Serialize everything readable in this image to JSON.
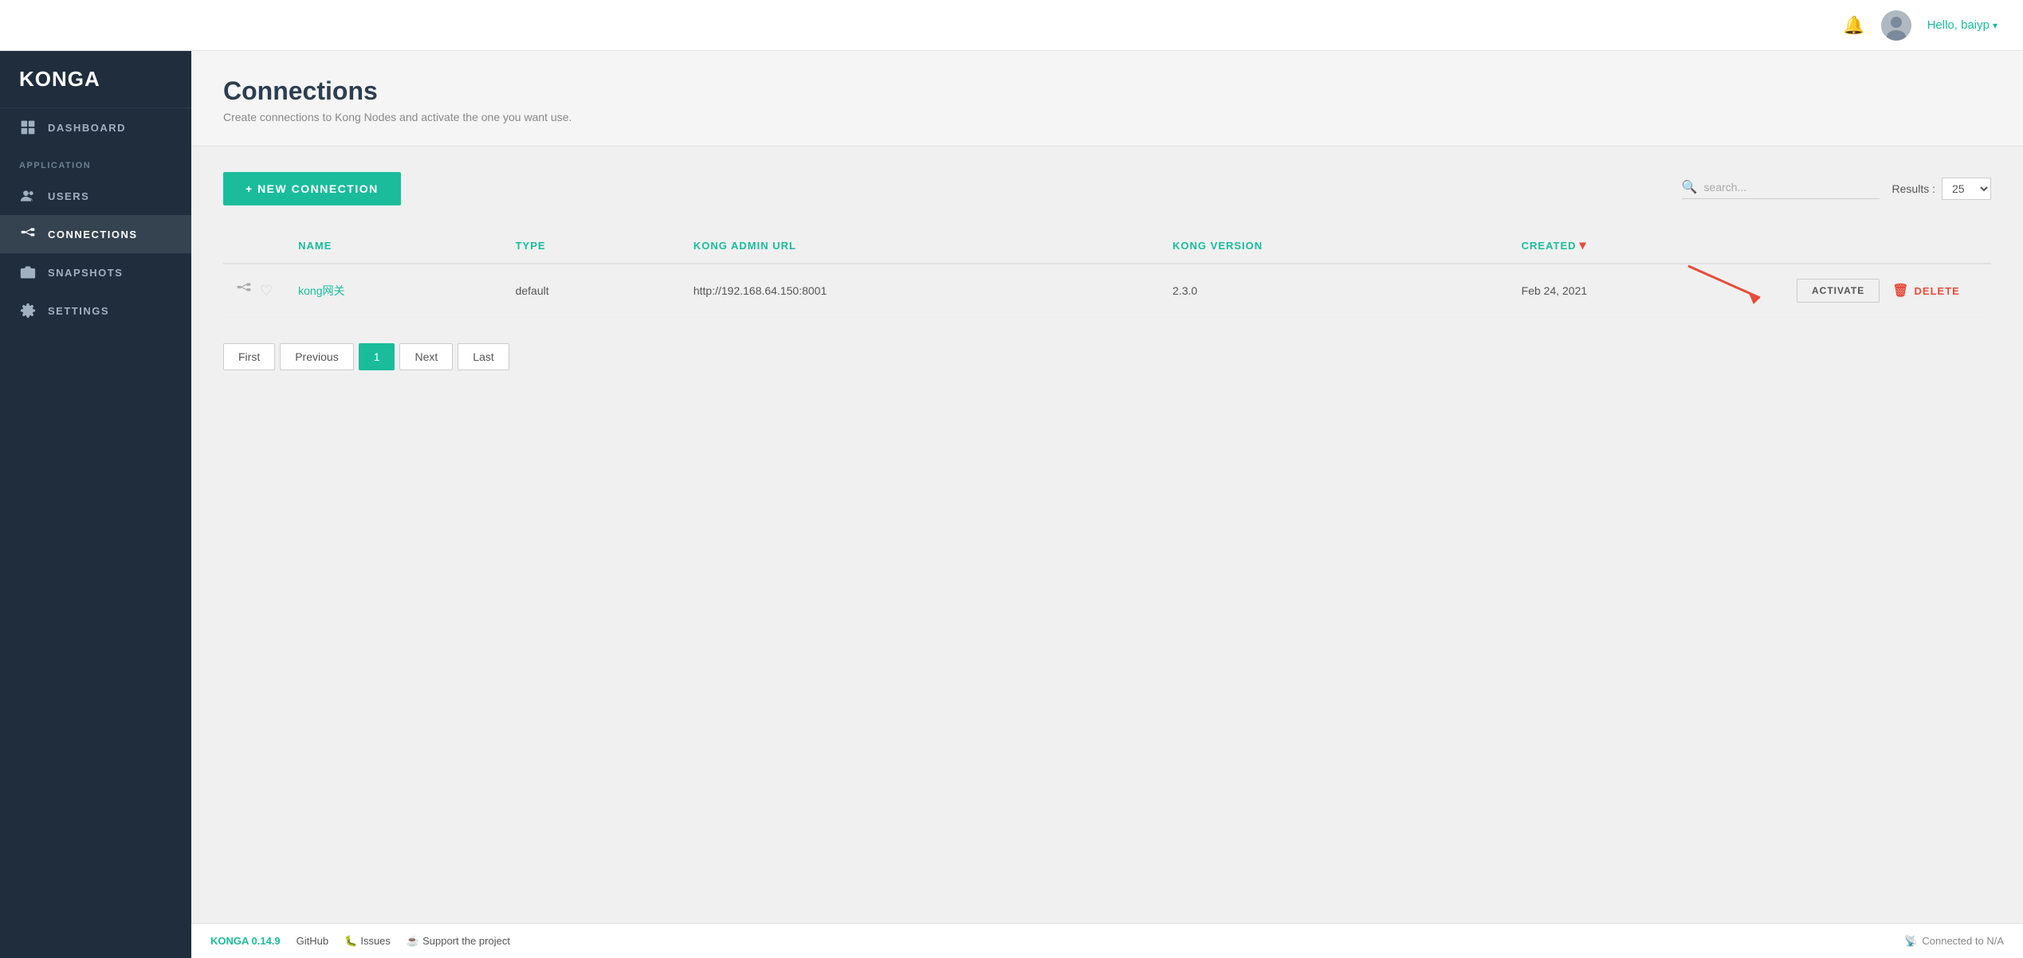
{
  "app": {
    "logo": "KONGA",
    "version": "KONGA 0.14.9"
  },
  "topbar": {
    "user_greeting": "Hello, baiyp",
    "chevron": "▾"
  },
  "sidebar": {
    "items": [
      {
        "id": "dashboard",
        "label": "DASHBOARD",
        "icon": "grid"
      },
      {
        "id": "section_application",
        "label": "APPLICATION",
        "type": "section"
      },
      {
        "id": "users",
        "label": "USERS",
        "icon": "users"
      },
      {
        "id": "connections",
        "label": "CONNECTIONS",
        "icon": "connections",
        "active": true
      },
      {
        "id": "snapshots",
        "label": "SNAPSHOTS",
        "icon": "camera"
      },
      {
        "id": "settings",
        "label": "SETTINGS",
        "icon": "gear"
      }
    ]
  },
  "page": {
    "title": "Connections",
    "subtitle": "Create connections to Kong Nodes and activate the one you want use."
  },
  "toolbar": {
    "new_connection_label": "+ NEW CONNECTION",
    "search_placeholder": "search...",
    "results_label": "Results :",
    "results_value": "25"
  },
  "table": {
    "columns": [
      {
        "id": "icon",
        "label": ""
      },
      {
        "id": "name",
        "label": "NAME"
      },
      {
        "id": "type",
        "label": "TYPE"
      },
      {
        "id": "kong_admin_url",
        "label": "KONG ADMIN URL"
      },
      {
        "id": "kong_version",
        "label": "KONG VERSION"
      },
      {
        "id": "created",
        "label": "CREATED"
      },
      {
        "id": "actions",
        "label": ""
      }
    ],
    "rows": [
      {
        "name": "kong网关",
        "type": "default",
        "kong_admin_url": "http://192.168.64.150:8001",
        "kong_version": "2.3.0",
        "created": "Feb 24, 2021",
        "activate_label": "ACTIVATE",
        "delete_label": "DELETE"
      }
    ]
  },
  "pagination": {
    "first_label": "First",
    "previous_label": "Previous",
    "current_page": "1",
    "next_label": "Next",
    "last_label": "Last"
  },
  "footer": {
    "version": "KONGA 0.14.9",
    "github_label": "GitHub",
    "issues_label": "Issues",
    "support_label": "Support the project",
    "connected_label": "Connected to N/A"
  }
}
